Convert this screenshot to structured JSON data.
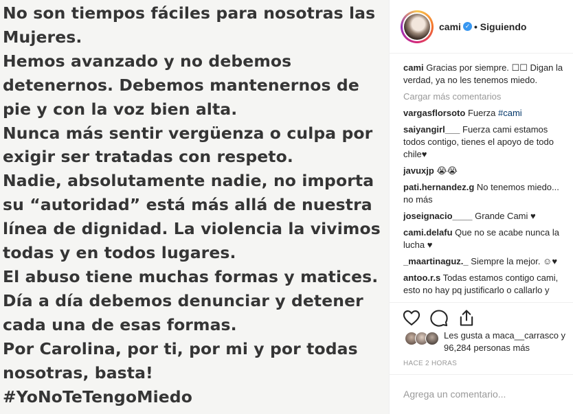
{
  "post": {
    "lines": [
      "No son tiempos fáciles para nosotras las",
      "Mujeres.",
      "Hemos avanzado y no debemos",
      "detenernos. Debemos mantenernos de",
      "pie y con la voz bien alta.",
      "Nunca más sentir vergüenza o culpa por",
      "exigir ser tratadas con respeto.",
      "Nadie, absolutamente nadie, no importa",
      "su “autoridad” está más allá de nuestra",
      "línea de dignidad. La violencia la vivimos",
      "todas y en todos lugares.",
      "El abuso tiene muchas formas y matices.",
      "Día a día debemos denunciar y detener",
      "cada una de esas formas.",
      "Por Carolina, por ti, por mi y por todas",
      "nosotras, basta!",
      "#YoNoTeTengoMiedo"
    ]
  },
  "header": {
    "username": "cami",
    "verified_icon": "verified-badge-icon",
    "follow_status": "• Siguiendo"
  },
  "caption": {
    "user": "cami",
    "text": "Gracias por siempre. ☐☐ Digan la verdad, ya no les tenemos miedo."
  },
  "load_more": "Cargar más comentarios",
  "comments": [
    {
      "user": "vargasflorsoto",
      "text": "Fuerza ",
      "tag": "#cami"
    },
    {
      "user": "saiyangirl___",
      "text": "Fuerza cami estamos todos contigo, tienes el apoyo de todo chile♥"
    },
    {
      "user": "javuxjp",
      "text": "😭😭"
    },
    {
      "user": "pati.hernandez.g",
      "text": "No tenemos miedo... no más"
    },
    {
      "user": "joseignacio____",
      "text": "Grande Cami ♥"
    },
    {
      "user": "cami.delafu",
      "text": "Que no se acabe nunca la lucha ♥"
    },
    {
      "user": "_maartinaguz._",
      "text": "Siempre la mejor. ☺♥"
    },
    {
      "user": "antoo.r.s",
      "text": "Todas estamos contigo cami, esto no hay pq justificarlo o callarlo y"
    }
  ],
  "actions": {
    "like_icon": "heart-icon",
    "comment_icon": "comment-icon",
    "share_icon": "share-icon"
  },
  "likes": {
    "text": "Les gusta a maca__carrasco y 96,284 personas más"
  },
  "timestamp": "HACE 2 HORAS",
  "add_comment": {
    "placeholder": "Agrega un comentario..."
  }
}
